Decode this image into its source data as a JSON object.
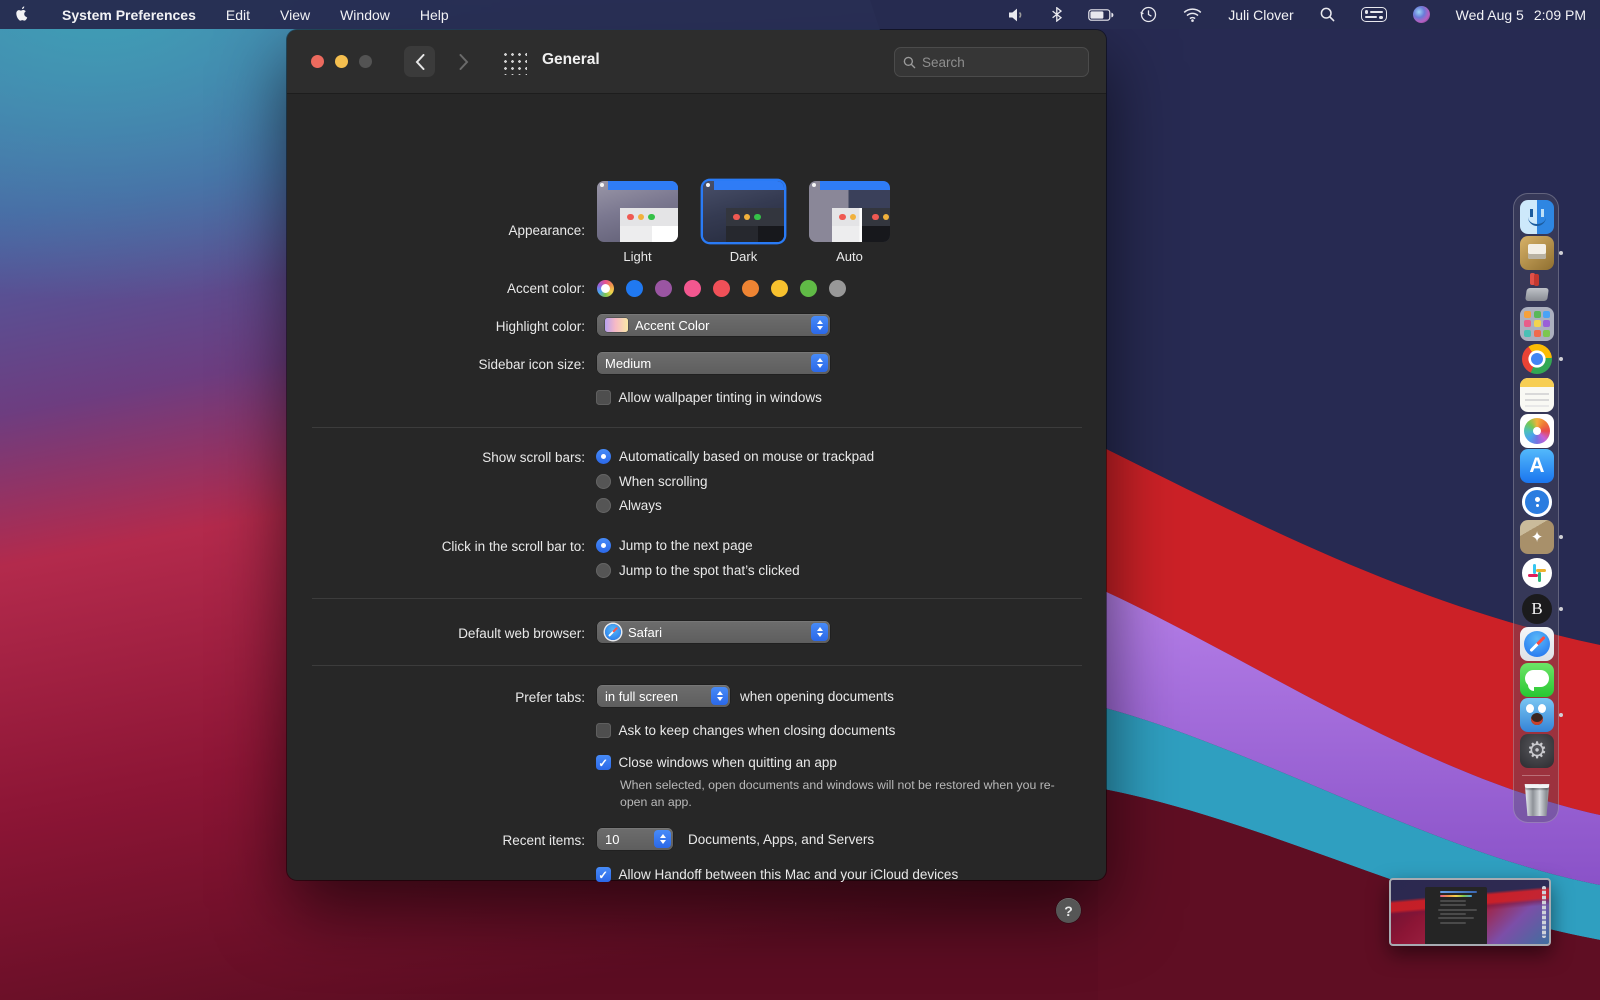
{
  "menu_bar": {
    "app_name": "System Preferences",
    "menus": [
      "Edit",
      "View",
      "Window",
      "Help"
    ],
    "status_icons": [
      "volume-icon",
      "bluetooth-icon",
      "battery-icon",
      "time-machine-icon",
      "wifi-icon",
      "spotlight-icon",
      "control-center-icon",
      "siri-icon"
    ],
    "username": "Juli Clover",
    "date": "Wed Aug 5",
    "time": "2:09 PM"
  },
  "window": {
    "title": "General",
    "search_placeholder": "Search",
    "appearance": {
      "label": "Appearance:",
      "options": [
        {
          "label": "Light"
        },
        {
          "label": "Dark"
        },
        {
          "label": "Auto"
        }
      ],
      "selected": "Dark"
    },
    "accent": {
      "label": "Accent color:",
      "selected": "Multicolor",
      "colors": [
        {
          "name": "Multicolor",
          "hex": "rainbow"
        },
        {
          "name": "Blue",
          "hex": "#2079f1"
        },
        {
          "name": "Purple",
          "hex": "#9a55a2"
        },
        {
          "name": "Pink",
          "hex": "#f2578f"
        },
        {
          "name": "Red",
          "hex": "#f05058"
        },
        {
          "name": "Orange",
          "hex": "#ee8433"
        },
        {
          "name": "Yellow",
          "hex": "#f7c12e"
        },
        {
          "name": "Green",
          "hex": "#60ba46"
        },
        {
          "name": "Graphite",
          "hex": "#989898"
        }
      ]
    },
    "highlight": {
      "label": "Highlight color:",
      "value": "Accent Color"
    },
    "sidebar_size": {
      "label": "Sidebar icon size:",
      "value": "Medium"
    },
    "tinting": {
      "label": "Allow wallpaper tinting in windows",
      "checked": false
    },
    "scrollbars": {
      "label": "Show scroll bars:",
      "options": [
        "Automatically based on mouse or trackpad",
        "When scrolling",
        "Always"
      ],
      "selected_index": 0
    },
    "scroll_click": {
      "label": "Click in the scroll bar to:",
      "options": [
        "Jump to the next page",
        "Jump to the spot that’s clicked"
      ],
      "selected_index": 0
    },
    "browser": {
      "label": "Default web browser:",
      "value": "Safari"
    },
    "prefer_tabs": {
      "label": "Prefer tabs:",
      "value": "in full screen",
      "suffix": "when opening documents"
    },
    "ask_changes": {
      "label": "Ask to keep changes when closing documents",
      "checked": false
    },
    "close_windows": {
      "label": "Close windows when quitting an app",
      "checked": true,
      "description": "When selected, open documents and windows will not be restored when you re-open an app."
    },
    "recent_items": {
      "label": "Recent items:",
      "value": "10",
      "suffix": "Documents, Apps, and Servers"
    },
    "handoff": {
      "label": "Allow Handoff between this Mac and your iCloud devices",
      "checked": true
    },
    "help_label": "?"
  },
  "dock": {
    "items": [
      {
        "name": "finder",
        "running": true
      },
      {
        "name": "gold-utility-app",
        "running": true
      },
      {
        "name": "plunger-utility-app",
        "running": false
      },
      {
        "name": "launchpad",
        "running": false
      },
      {
        "name": "chrome",
        "running": true
      },
      {
        "name": "notes",
        "running": false
      },
      {
        "name": "photos",
        "running": false
      },
      {
        "name": "app-store",
        "running": false
      },
      {
        "name": "1password",
        "running": false
      },
      {
        "name": "cardboard-box-app",
        "running": true
      },
      {
        "name": "slack",
        "running": false
      },
      {
        "name": "b-circle-app",
        "running": true
      },
      {
        "name": "safari",
        "running": false
      },
      {
        "name": "messages",
        "running": false
      },
      {
        "name": "tweetbot",
        "running": true
      },
      {
        "name": "system-preferences",
        "running": true
      },
      {
        "name": "trash",
        "running": false
      }
    ],
    "appstore_glyph": "A",
    "boxstar_glyph": "✦",
    "gear_glyph": "⚙"
  }
}
